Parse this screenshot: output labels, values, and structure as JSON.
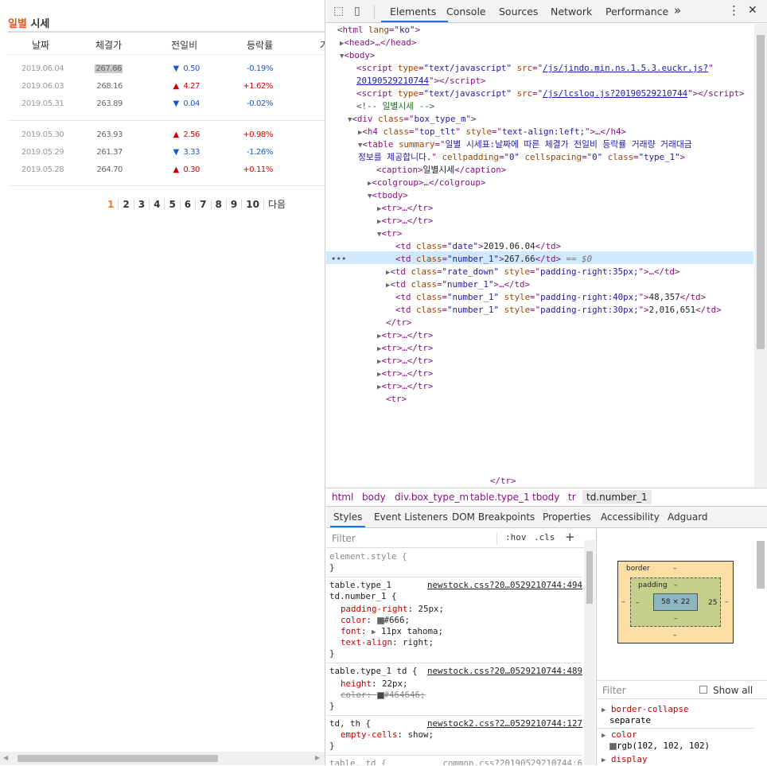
{
  "page": {
    "title_hl": "일별",
    "title_rest": " 시세",
    "headers": [
      "날짜",
      "체결가",
      "전일비",
      "등락률",
      "거"
    ],
    "rows_a": [
      {
        "date": "2019.06.04",
        "price": "267.66",
        "dir": "▼",
        "diff": "0.50",
        "pct": "-0.19%"
      },
      {
        "date": "2019.06.03",
        "price": "268.16",
        "dir": "▲",
        "diff": "4.27",
        "pct": "+1.62%"
      },
      {
        "date": "2019.05.31",
        "price": "263.89",
        "dir": "▼",
        "diff": "0.04",
        "pct": "-0.02%"
      }
    ],
    "rows_b": [
      {
        "date": "2019.05.30",
        "price": "263.93",
        "dir": "▲",
        "diff": "2.56",
        "pct": "+0.98%"
      },
      {
        "date": "2019.05.29",
        "price": "261.37",
        "dir": "▼",
        "diff": "3.33",
        "pct": "-1.26%"
      },
      {
        "date": "2019.05.28",
        "price": "264.70",
        "dir": "▲",
        "diff": "0.30",
        "pct": "+0.11%"
      }
    ],
    "pager": [
      "1",
      "2",
      "3",
      "4",
      "5",
      "6",
      "7",
      "8",
      "9",
      "10",
      "다음"
    ]
  },
  "devtools": {
    "tabs": [
      "Elements",
      "Console",
      "Sources",
      "Network",
      "Performance"
    ],
    "more": "»",
    "close": "✕",
    "dom": {
      "l0": "<html lang=\"ko\">",
      "head": "<head>…</head>",
      "body": "<body>",
      "s1_src": "/js/jindo.min.ns.1.5.3.euckr.js?",
      "s1_src2": "20190529210744",
      "s2_src": "/js/lcslog.js?20190529210744",
      "comment": "<!-- 일별시세 -->",
      "div": "box_type_m",
      "h4": "top_tlt",
      "h4_style": "text-align:left;",
      "table_summary": "일별 시세표:날짜에 따른 체결가 전일비 등락률 거래량 거래대금",
      "table_summary2": "정보를 제공합니다.",
      "caption": "일별시세",
      "td_date": "2019.06.04",
      "td_num": "267.66",
      "td_sel_suffix": " == $0",
      "td_rate_style": "padding-right:35px;",
      "td_vol_style": "padding-right:40px;",
      "td_vol": "48,357",
      "td_amt_style": "padding-right:30px;",
      "td_amt": "2,016,651"
    },
    "crumbs": [
      "html",
      "body",
      "div.box_type_m",
      "table.type_1",
      "tbody",
      "tr",
      "td.number_1"
    ],
    "subtabs": [
      "Styles",
      "Event Listeners",
      "DOM Breakpoints",
      "Properties",
      "Accessibility",
      "Adguard"
    ],
    "styles": {
      "filter_placeholder": "Filter",
      "hov": ":hov",
      "cls": ".cls",
      "plus": "+",
      "element_style": "element.style {",
      "src1": "newstock.css?20…0529210744:494",
      "src2": "newstock.css?20…0529210744:489",
      "src3": "newstock2.css?2…0529210744:127",
      "src4": "common.css?20190529210744:6",
      "r1a": "table.type_1",
      "r1b": "td.number_1 {",
      "p_padding": "padding-right",
      "v_padding": "25px;",
      "p_color": "color",
      "v_color": "#666;",
      "p_font": "font",
      "v_font": "11px tahoma;",
      "p_align": "text-align",
      "v_align": "right;",
      "r2": "table.type_1 td {",
      "p_height": "height",
      "v_height": "22px;",
      "v_color2": "#464646;",
      "r3": "td, th {",
      "p_empty": "empty-cells",
      "v_empty": "show;",
      "r4": "table, td {",
      "close": "}"
    },
    "boxmodel": {
      "border_label": "border",
      "padding_label": "padding",
      "dash": "–",
      "content": "58 × 22",
      "padding_right": "25"
    },
    "computed": {
      "filter_placeholder": "Filter",
      "show_all": "Show all",
      "p1": "border-collapse",
      "v1": "separate",
      "p2": "color",
      "v2": "rgb(102, 102, 102)",
      "p3": "display"
    },
    "colors": {
      "swatch_666": "#666666",
      "swatch_464646": "#464646",
      "accent": "#1a73e8"
    }
  }
}
